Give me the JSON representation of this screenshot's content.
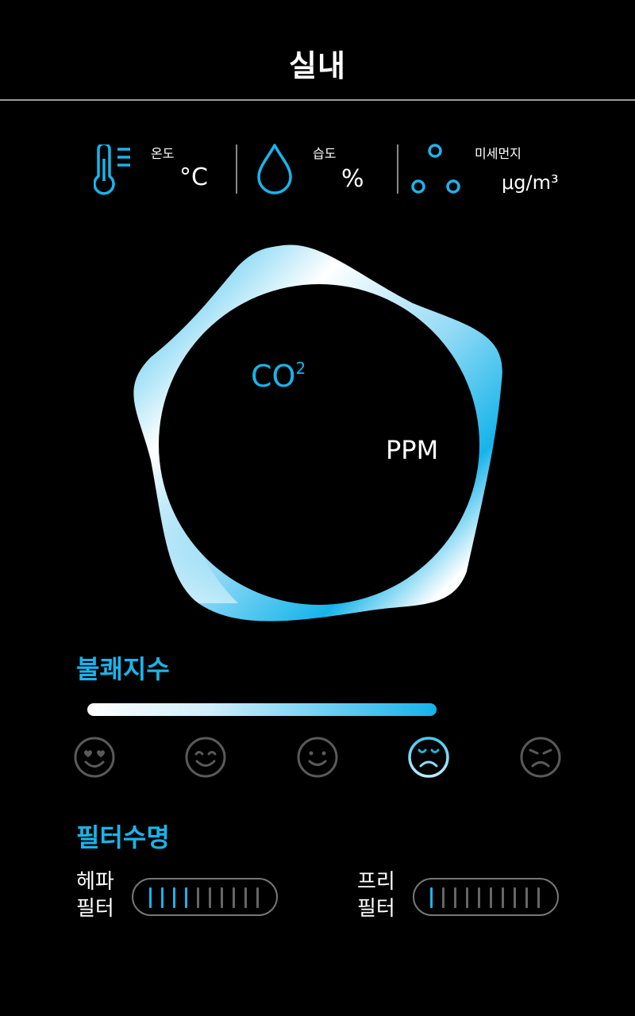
{
  "header": {
    "title": "실내"
  },
  "stats": [
    {
      "icon": "thermometer-icon",
      "label": "온도",
      "unit": "°C"
    },
    {
      "icon": "water-drop-icon",
      "label": "습도",
      "unit": "%"
    },
    {
      "icon": "dust-particles-icon",
      "label": "미세먼지",
      "unit": "μg/m³"
    }
  ],
  "air_quality": {
    "label_main": "CO",
    "label_sup": "2",
    "unit": "PPM"
  },
  "discomfort": {
    "title": "불쾌지수",
    "level_fraction": 1.0,
    "faces": [
      "love-face-icon",
      "big-smile-face-icon",
      "smile-face-icon",
      "sad-face-icon",
      "angry-face-icon"
    ],
    "selected_index": 3
  },
  "filter_life": {
    "title": "필터수명",
    "filters": [
      {
        "label_line1": "헤파",
        "label_line2": "필터",
        "segments_total": 10,
        "segments_on": 4
      },
      {
        "label_line1": "프리",
        "label_line2": "필터",
        "segments_total": 10,
        "segments_on": 1
      }
    ]
  },
  "colors": {
    "accent": "#1ab4ea",
    "background": "#000000",
    "inactive": "#666666"
  }
}
